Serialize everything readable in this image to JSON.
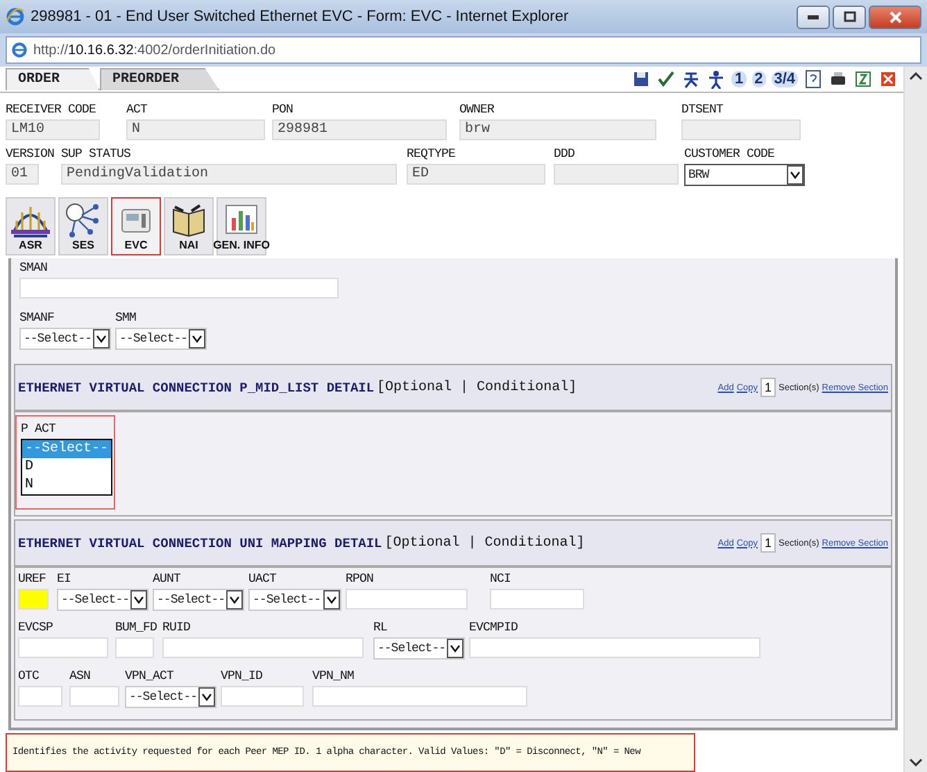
{
  "window": {
    "title": "298981 - 01 - End User Switched Ethernet EVC - Form: EVC - Internet Explorer"
  },
  "address_bar": {
    "url": "http://**10.16.6.32**:4002/orderInitiation.do"
  },
  "tabs": [
    {
      "label": "ORDER",
      "selected": true
    },
    {
      "label": "PREORDER",
      "selected": false
    }
  ],
  "toolbar": [
    {
      "kind": "icon"
    },
    {
      "kind": "icon"
    },
    {
      "kind": "icon"
    },
    {
      "kind": "icon"
    },
    {
      "kind": "text",
      "label": "1"
    },
    {
      "kind": "text",
      "label": "2"
    },
    {
      "kind": "text",
      "label": "3/4"
    },
    {
      "kind": "icon"
    },
    {
      "kind": "icon"
    },
    {
      "kind": "icon"
    },
    {
      "kind": "icon"
    }
  ],
  "header_rows": [
    {
      "fields": [
        {
          "label": "RECEIVER CODE",
          "kind": "text",
          "value": "LM10"
        },
        {
          "label": "ACT",
          "kind": "text",
          "value": "N"
        },
        {
          "label": "PON",
          "kind": "text",
          "value": "298981"
        },
        {
          "label": "OWNER",
          "kind": "text",
          "value": "brw"
        },
        {
          "label": "DTSENT",
          "kind": "text"
        }
      ]
    },
    {
      "fields": [
        {
          "label": "VERSION",
          "kind": "text",
          "value": "01"
        },
        {
          "label": "SUP STATUS",
          "kind": "text",
          "value": "PendingValidation"
        },
        {
          "label": "REQTYPE",
          "kind": "text",
          "value": "ED"
        },
        {
          "label": "DDD",
          "kind": "text"
        },
        {
          "label": "CUSTOMER CODE",
          "kind": "select",
          "value": "BRW"
        }
      ]
    }
  ],
  "form_tabs": [
    {
      "label": "ASR",
      "selected": false
    },
    {
      "label": "SES",
      "selected": false
    },
    {
      "label": "EVC",
      "selected": true
    },
    {
      "label": "NAI",
      "selected": false
    },
    {
      "label": "GEN. INFO",
      "selected": false
    }
  ],
  "top_rows": [
    {
      "fields": [
        {
          "label": "SMAN",
          "kind": "text"
        }
      ]
    },
    {
      "fields": [
        {
          "label": "SMANF",
          "kind": "select",
          "value": "--Select--"
        },
        {
          "label": "SMM",
          "kind": "select",
          "value": "--Select--"
        }
      ]
    }
  ],
  "sections": [
    {
      "title": "ETHERNET VIRTUAL CONNECTION P_MID_LIST DETAIL",
      "qualifier": "[Optional | Conditional]",
      "add": "Add",
      "copy": "Copy",
      "count": "1",
      "count_label": "Section(s)",
      "remove": "Remove Section",
      "field": {
        "label": "P ACT",
        "options": [
          {
            "label": "--Select--",
            "selected": true
          },
          {
            "label": "D",
            "selected": false
          },
          {
            "label": "N",
            "selected": false
          }
        ]
      }
    },
    {
      "title": "ETHERNET VIRTUAL CONNECTION UNI MAPPING DETAIL",
      "qualifier": "[Optional | Conditional]",
      "add": "Add",
      "copy": "Copy",
      "count": "1",
      "count_label": "Section(s)",
      "remove": "Remove Section",
      "rows": [
        {
          "fields": [
            {
              "label": "UREF",
              "kind": "required"
            },
            {
              "label": "EI",
              "kind": "select",
              "value": "--Select--"
            },
            {
              "label": "AUNT",
              "kind": "select",
              "value": "--Select--"
            },
            {
              "label": "UACT",
              "kind": "select",
              "value": "--Select--"
            },
            {
              "label": "RPON",
              "kind": "text"
            },
            {
              "label": "NCI",
              "kind": "text"
            }
          ]
        },
        {
          "fields": [
            {
              "label": "EVCSP",
              "kind": "text"
            },
            {
              "label": "BUM_FD",
              "kind": "text"
            },
            {
              "label": "RUID",
              "kind": "text"
            },
            {
              "label": "RL",
              "kind": "select",
              "value": "--Select--"
            },
            {
              "label": "EVCMPID",
              "kind": "text"
            }
          ]
        },
        {
          "fields": [
            {
              "label": "OTC",
              "kind": "text"
            },
            {
              "label": "ASN",
              "kind": "text"
            },
            {
              "label": "VPN_ACT",
              "kind": "select",
              "value": "--Select--"
            },
            {
              "label": "VPN_ID",
              "kind": "text"
            },
            {
              "label": "VPN_NM",
              "kind": "text"
            }
          ]
        }
      ]
    }
  ],
  "help_text": "Identifies the activity requested for each Peer MEP ID. 1 alpha character. Valid Values: \"D\" = Disconnect, \"N\" = New"
}
